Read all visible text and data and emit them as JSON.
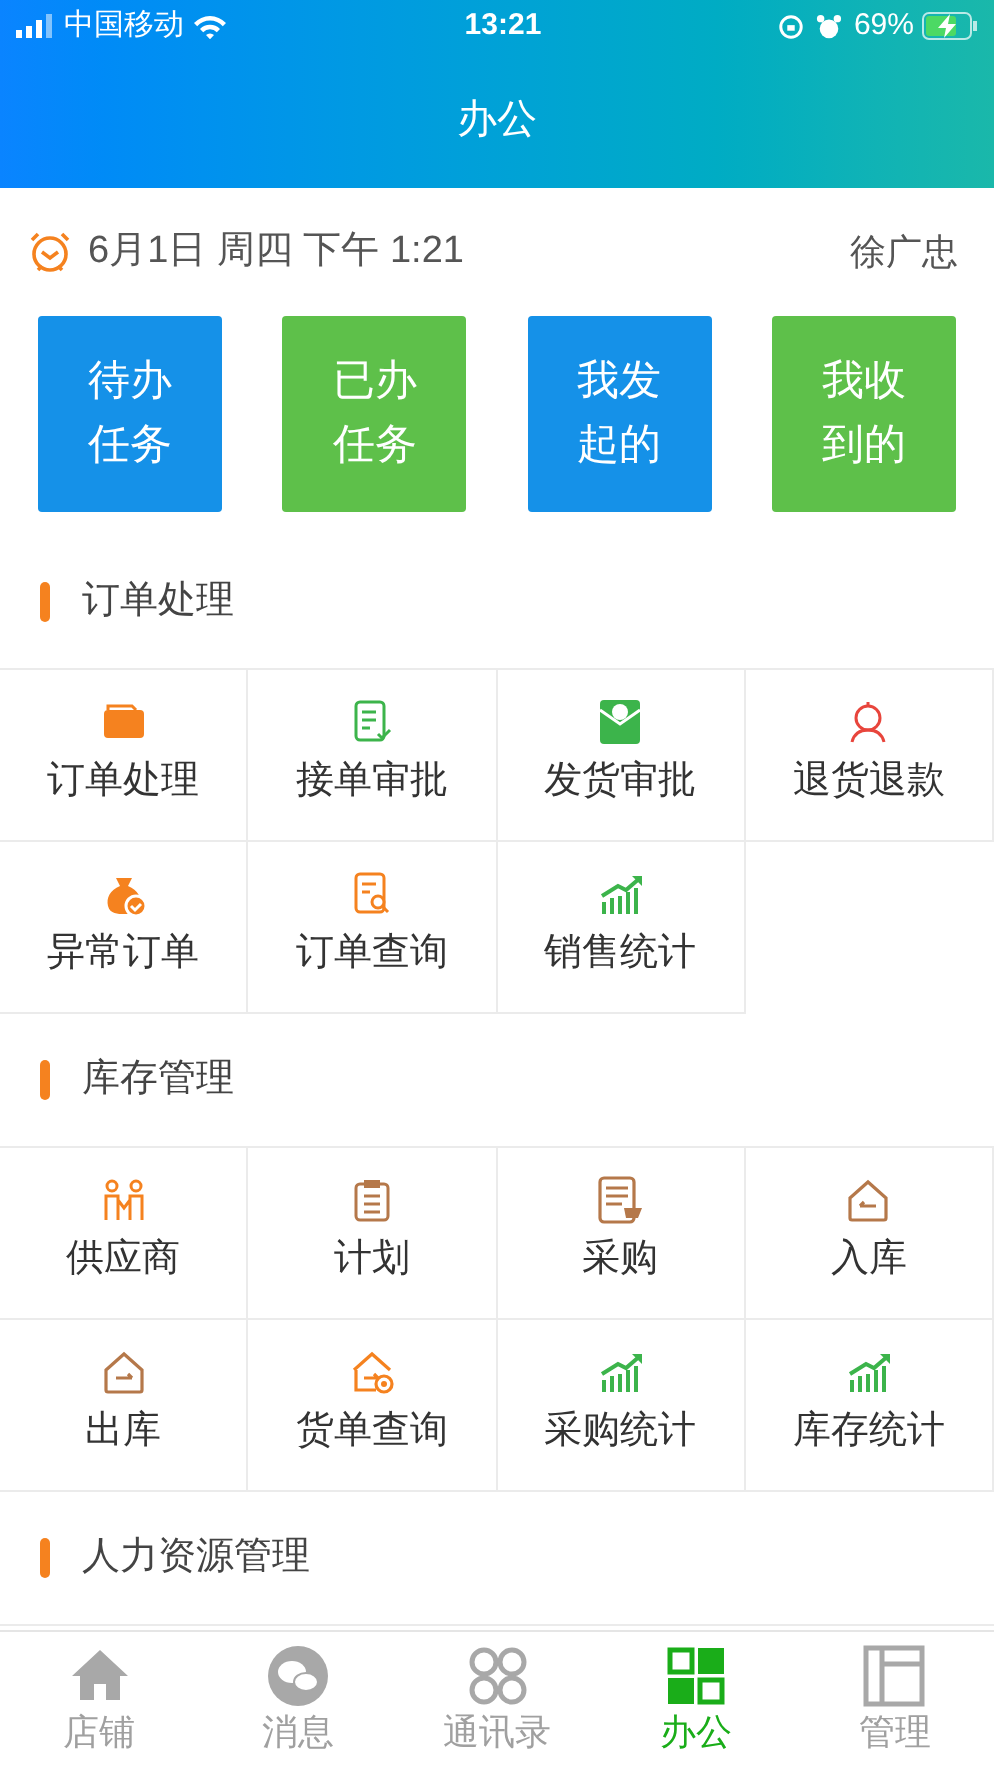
{
  "status_bar": {
    "carrier": "中国移动",
    "time": "13:21",
    "battery": "69%"
  },
  "header": {
    "title": "办公"
  },
  "info": {
    "date": "6月1日 周四 下午 1:21",
    "user": "徐广忠"
  },
  "quick_actions": [
    {
      "label": "待办任务",
      "color": "#1591e8"
    },
    {
      "label": "已办任务",
      "color": "#5ec04a"
    },
    {
      "label": "我发起的",
      "color": "#1591e8"
    },
    {
      "label": "我收到的",
      "color": "#5ec04a"
    }
  ],
  "sections": [
    {
      "title": "订单处理",
      "items": [
        {
          "label": "订单处理",
          "kind": "folder"
        },
        {
          "label": "接单审批",
          "kind": "doc-check"
        },
        {
          "label": "发货审批",
          "kind": "envelope"
        },
        {
          "label": "退货退款",
          "kind": "person"
        },
        {
          "label": "异常订单",
          "kind": "bag"
        },
        {
          "label": "订单查询",
          "kind": "doc-search"
        },
        {
          "label": "销售统计",
          "kind": "chart"
        }
      ]
    },
    {
      "title": "库存管理",
      "items": [
        {
          "label": "供应商",
          "kind": "people"
        },
        {
          "label": "计划",
          "kind": "clipboard"
        },
        {
          "label": "采购",
          "kind": "doc-cart"
        },
        {
          "label": "入库",
          "kind": "house-in"
        },
        {
          "label": "出库",
          "kind": "house-out"
        },
        {
          "label": "货单查询",
          "kind": "house-search"
        },
        {
          "label": "采购统计",
          "kind": "chart"
        },
        {
          "label": "库存统计",
          "kind": "chart"
        }
      ]
    },
    {
      "title": "人力资源管理"
    }
  ],
  "tab_bar": [
    {
      "label": "店铺",
      "kind": "home",
      "selected": false
    },
    {
      "label": "消息",
      "kind": "chat",
      "selected": false
    },
    {
      "label": "通讯录",
      "kind": "contacts",
      "selected": false
    },
    {
      "label": "办公",
      "kind": "office",
      "selected": true
    },
    {
      "label": "管理",
      "kind": "manage",
      "selected": false
    }
  ]
}
